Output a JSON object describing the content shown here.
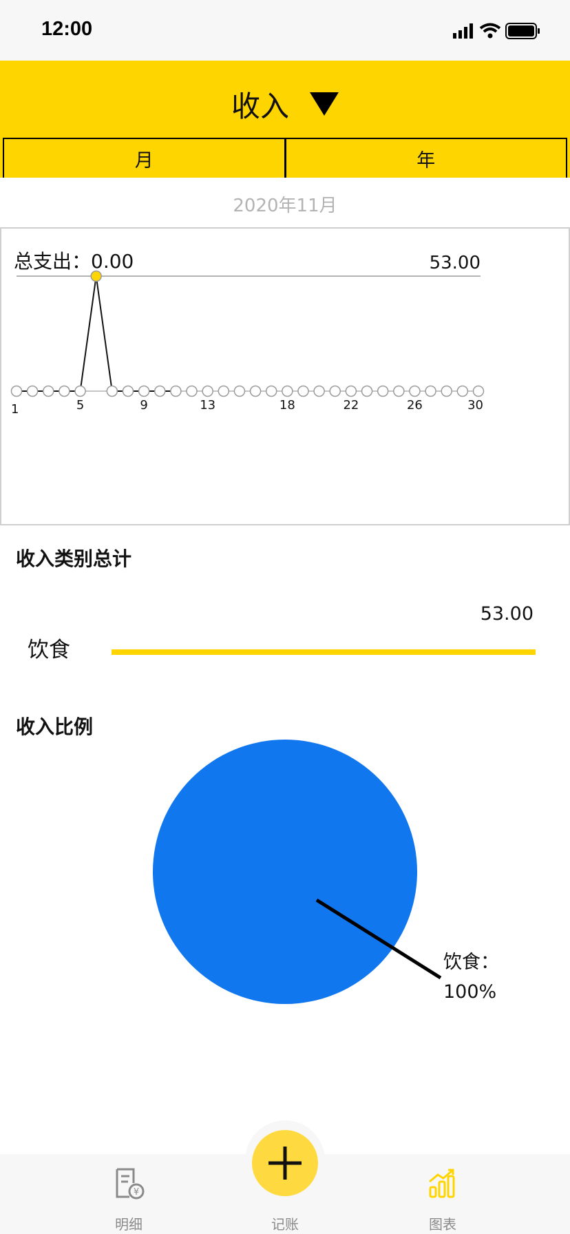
{
  "status_bar": {
    "time": "12:00"
  },
  "header": {
    "title": "收入",
    "segments": [
      "月",
      "年"
    ]
  },
  "period_label": "2020年11月",
  "line_chart": {
    "total_label": "总支出：0.00",
    "max_label": "53.00"
  },
  "chart_data": [
    {
      "type": "line",
      "x_tick_labels": [
        "1",
        "5",
        "9",
        "13",
        "18",
        "22",
        "26",
        "30"
      ],
      "y_max_label": "53.00",
      "x": [
        1,
        2,
        3,
        4,
        5,
        6,
        7,
        8,
        9,
        10,
        11,
        12,
        13,
        14,
        15,
        16,
        17,
        18,
        19,
        20,
        21,
        22,
        23,
        24,
        25,
        26,
        27,
        28,
        29,
        30
      ],
      "y": [
        0,
        0,
        0,
        0,
        0,
        53,
        0,
        0,
        0,
        0,
        0,
        0,
        0,
        0,
        0,
        0,
        0,
        0,
        0,
        0,
        0,
        0,
        0,
        0,
        0,
        0,
        0,
        0,
        0,
        0
      ],
      "ylim": [
        0,
        53
      ],
      "highlight_color": "#ffd500"
    },
    {
      "type": "pie",
      "slices": [
        {
          "label": "饮食",
          "value": 100,
          "color": "#1177ee"
        }
      ]
    }
  ],
  "category_totals": {
    "title": "收入类别总计",
    "items": [
      {
        "name": "饮食",
        "amount": "53.00",
        "fraction": 1.0
      }
    ]
  },
  "ratio": {
    "title": "收入比例",
    "slice_label": "饮食：",
    "slice_percent": "100%"
  },
  "tabbar": {
    "tabs": [
      {
        "label": "明细",
        "icon": "bill-icon"
      },
      {
        "label": "记账",
        "icon": "plus-icon"
      },
      {
        "label": "图表",
        "icon": "bar-chart-icon"
      }
    ]
  },
  "colors": {
    "accent": "#ffd500",
    "pie": "#1177ee"
  }
}
